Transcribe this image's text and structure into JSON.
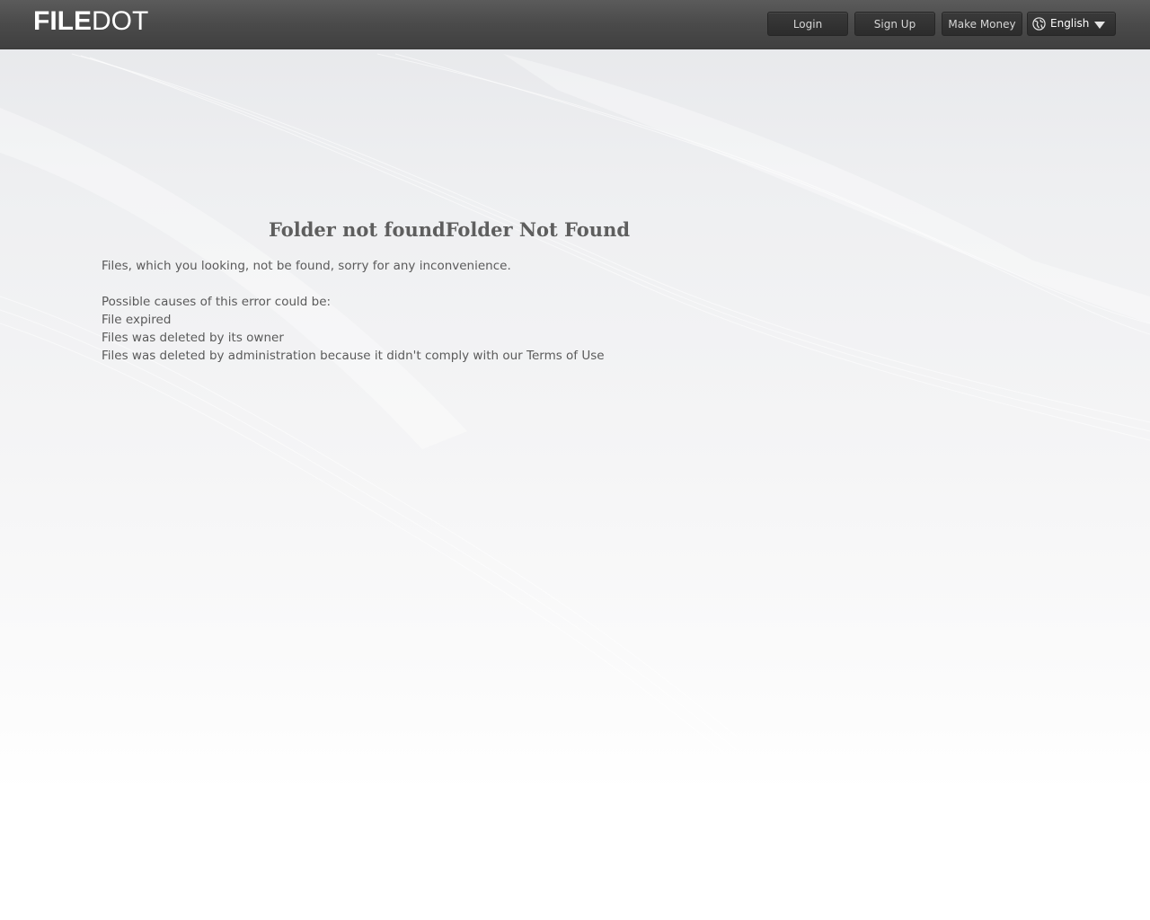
{
  "header": {
    "logo_bold": "FILE",
    "logo_light": "DOT",
    "login_label": "Login",
    "signup_label": "Sign Up",
    "make_money_label": "Make Money",
    "language": {
      "selected": "English",
      "icon": "globe-icon"
    }
  },
  "main": {
    "title": "Folder not foundFolder Not Found",
    "intro": "Files, which you looking, not be found, sorry for any inconvenience.",
    "causes_heading": "Possible causes of this error could be:",
    "causes": [
      "File expired",
      "Files was deleted by its owner",
      "Files was deleted by administration because it didn't comply with our Terms of Use"
    ]
  },
  "colors": {
    "header_bg": "#4a4a4a",
    "button_bg": "#2f2f2f",
    "text": "#5a5a5a",
    "title": "#5e5e5e"
  }
}
